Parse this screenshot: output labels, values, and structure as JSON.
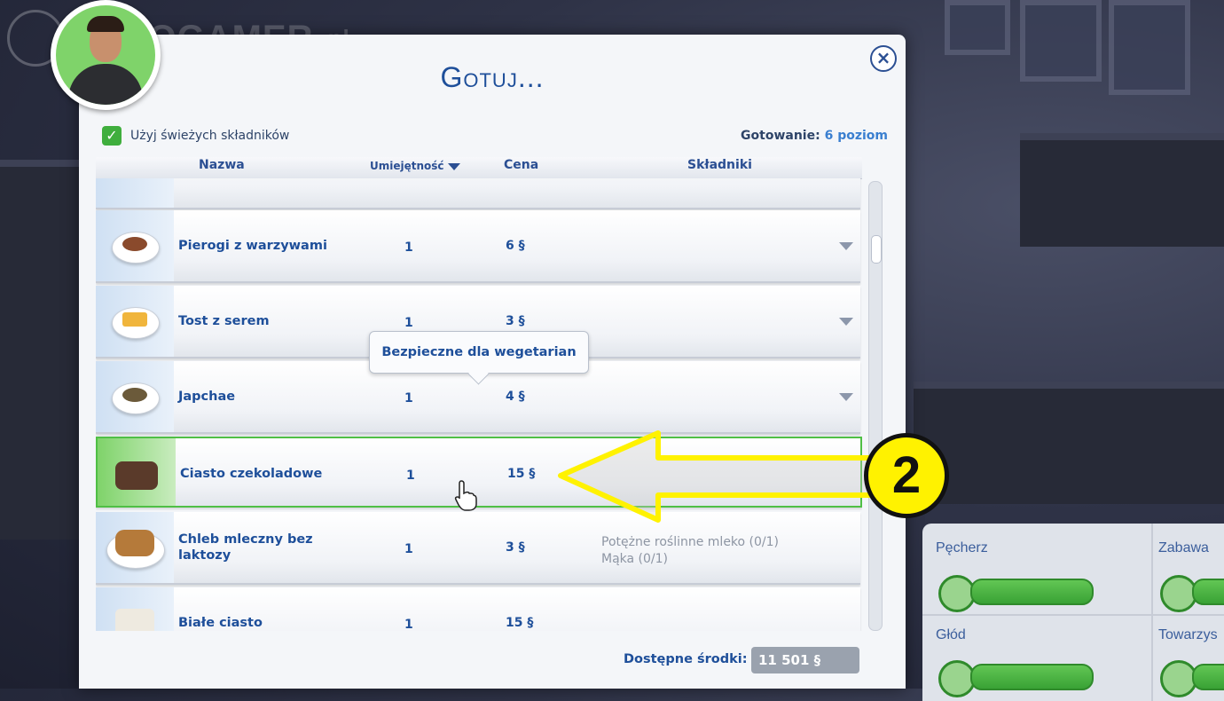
{
  "watermark": {
    "text": "EUROGAMER",
    "suffix": ".pl"
  },
  "dialog": {
    "title": "Gotuj...",
    "close_symbol": "×",
    "fresh_ingredients": {
      "checked": true,
      "check_symbol": "✓",
      "label": "Użyj świeżych składników"
    },
    "skill_level": {
      "label": "Gotowanie:",
      "value": "6 poziom"
    },
    "columns": {
      "name": "Nazwa",
      "skill": "Umiejętność",
      "price": "Cena",
      "ingredients": "Składniki"
    },
    "recipes": [
      {
        "name": "Pierogi z warzywami",
        "skill": "1",
        "price": "6 §",
        "ingredients": []
      },
      {
        "name": "Tost z serem",
        "skill": "1",
        "price": "3 §",
        "ingredients": []
      },
      {
        "name": "Japchae",
        "skill": "1",
        "price": "4 §",
        "ingredients": []
      },
      {
        "name": "Ciasto czekoladowe",
        "skill": "1",
        "price": "15 §",
        "ingredients": [],
        "selected": true
      },
      {
        "name": "Chleb mleczny bez laktozy",
        "skill": "1",
        "price": "3 §",
        "ingredients": [
          "Potężne roślinne mleko (0/1)",
          "Mąka (0/1)"
        ]
      },
      {
        "name": "Białe ciasto",
        "skill": "1",
        "price": "15 §",
        "ingredients": []
      }
    ],
    "tooltip": "Bezpieczne dla wegetarian",
    "funds": {
      "label": "Dostępne środki:",
      "value": "11 501 §"
    }
  },
  "needs": [
    {
      "label": "Pęcherz",
      "level": 1.0
    },
    {
      "label": "Zabawa",
      "level": 1.0
    },
    {
      "label": "Głód",
      "level": 1.0
    },
    {
      "label": "Towarzys",
      "level": 1.0
    }
  ],
  "annotation": {
    "badge": "2",
    "arrow_color": "#fff200"
  },
  "colors": {
    "title": "#1e4f9a",
    "selected_border": "#4fbf45",
    "check": "#3fae3d",
    "need_bar": "#39a235"
  }
}
